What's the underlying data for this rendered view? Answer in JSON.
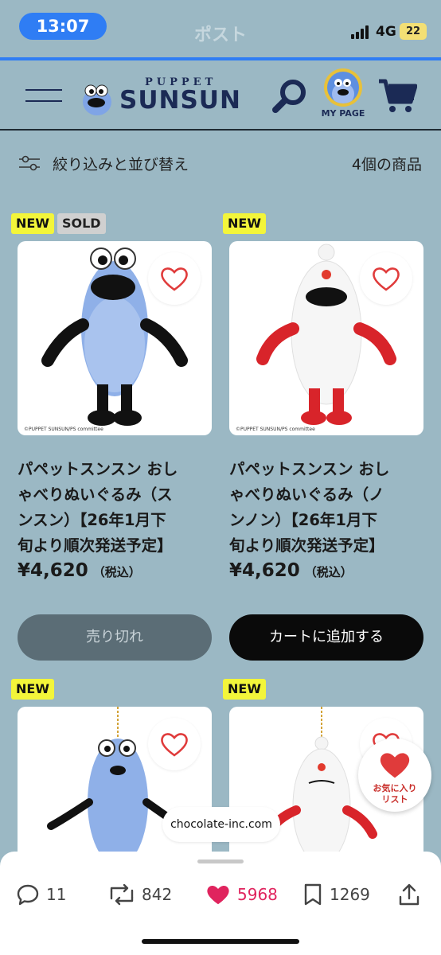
{
  "status_bar": {
    "time": "13:07",
    "page_title": "ポスト",
    "network": "4G",
    "battery": "22",
    "load_progress": 1.0
  },
  "header": {
    "logo_top": "PUPPET",
    "logo_main": "SUNSUN",
    "mypage_label": "MY PAGE",
    "icons": [
      "menu-icon",
      "search-icon",
      "mypage-avatar",
      "cart-icon"
    ]
  },
  "filter_bar": {
    "label": "絞り込みと並び替え",
    "count": "4個の商品"
  },
  "products": [
    {
      "badges": [
        "NEW",
        "SOLD"
      ],
      "title_lines": [
        "パペットスンスン おし",
        "ゃべりぬいぐるみ（ス",
        "ンスン）【26年1月下",
        "旬より順次発送予定】"
      ],
      "price": "¥4,620",
      "tax_label": "（税込）",
      "button_label": "売り切れ",
      "copyright": "©PUPPET SUNSUN/PS committee"
    },
    {
      "badges": [
        "NEW"
      ],
      "title_lines": [
        "パペットスンスン おし",
        "ゃべりぬいぐるみ（ノ",
        "ンノン）【26年1月下",
        "旬より順次発送予定】"
      ],
      "price": "¥4,620",
      "tax_label": "（税込）",
      "button_label": "カートに追加する",
      "copyright": "©PUPPET SUNSUN/PS committee"
    },
    {
      "badges": [
        "NEW"
      ]
    },
    {
      "badges": [
        "NEW"
      ]
    }
  ],
  "favorites_float": {
    "line1": "お気に入り",
    "line2": "リスト"
  },
  "url_pill": "chocolate-inc.com",
  "action_bar": {
    "replies": "11",
    "reposts": "842",
    "likes": "5968",
    "bookmarks": "1269"
  },
  "colors": {
    "background": "#9bb8c4",
    "navy": "#1b2a55",
    "new_badge": "#f3f53a",
    "sold_button": "#5b6d76",
    "like_pink": "#e0245e",
    "heart_red": "#e03b3b"
  }
}
